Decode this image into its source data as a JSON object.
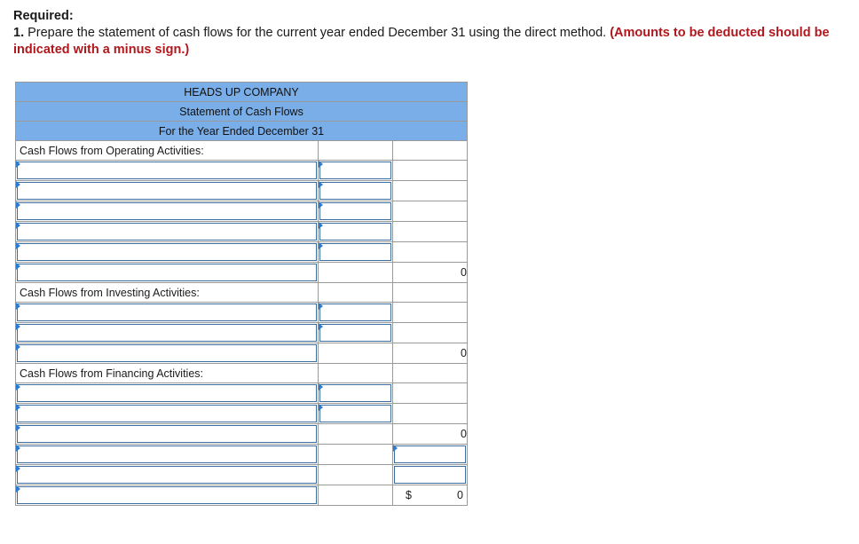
{
  "instructions": {
    "heading": "Required:",
    "number": "1.",
    "text": " Prepare the statement of cash flows for the current year ended December 31 using the direct method. ",
    "note": "(Amounts to be deducted should be indicated with a minus sign.)"
  },
  "statement": {
    "company": "HEADS UP COMPANY",
    "title": "Statement of Cash Flows",
    "period": "For the Year Ended December 31",
    "operating_label": "Cash Flows from Operating Activities:",
    "investing_label": "Cash Flows from Investing Activities:",
    "financing_label": "Cash Flows from Financing Activities:",
    "operating_total": "0",
    "investing_total": "0",
    "financing_total": "0",
    "final_currency": "$",
    "final_total": "0"
  }
}
